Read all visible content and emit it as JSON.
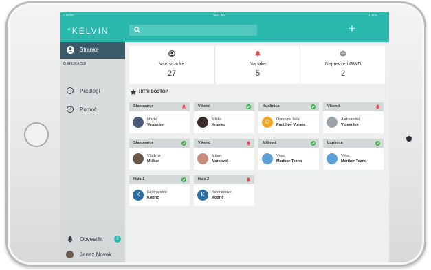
{
  "status_bar": {
    "carrier": "Carrier",
    "time": "9:41 AM",
    "battery": "100%"
  },
  "app": {
    "logo": "°KELVIN",
    "accent": "#2bb8ad"
  },
  "search": {
    "placeholder": ""
  },
  "sidebar": {
    "active": {
      "label": "Stranke",
      "icon": "user-circle-icon"
    },
    "section_label": "O APLIKACIJI",
    "items": [
      {
        "label": "Predlogi",
        "icon": "chat-bubble-icon"
      },
      {
        "label": "Pomoč",
        "icon": "help-icon"
      }
    ],
    "notifications": {
      "label": "Obvestila",
      "count": "2",
      "icon": "bell-icon"
    },
    "user": {
      "name": "Janez Novak"
    }
  },
  "stats": [
    {
      "label": "Vse stranke",
      "value": "27",
      "icon": "user-circle-icon",
      "color": "#333333"
    },
    {
      "label": "Napake",
      "value": "5",
      "icon": "bell-icon",
      "color": "#e84b4b"
    },
    {
      "label": "Neprevzeti GWD",
      "value": "2",
      "icon": "dots-icon",
      "color": "#8a8a8a"
    }
  ],
  "quick_access": {
    "title": "HITRI DOSTOP",
    "cards": [
      {
        "title": "Stanovanje",
        "status": "alert",
        "line1": "Marko",
        "line2": "Verderber",
        "avatar_color": "#4a5a78"
      },
      {
        "title": "Vikend",
        "status": "ok",
        "line1": "Miško",
        "line2": "Kranjec",
        "avatar_color": "#3b2b2b"
      },
      {
        "title": "Kuslinica",
        "status": "ok",
        "line1": "Osnovna šola",
        "line2": "Prežihov Voranc",
        "avatar_color": "#f5a623",
        "avatar_text": "O"
      },
      {
        "title": "Vikend",
        "status": "alert",
        "line1": "Aleksander",
        "line2": "Videmšek",
        "avatar_color": "#9aa4aa"
      },
      {
        "title": "Stanovanje",
        "status": "ok",
        "line1": "Vladimir",
        "line2": "Miškar",
        "avatar_color": "#6b5a4a"
      },
      {
        "title": "Vikend",
        "status": "alert",
        "line1": "Miran",
        "line2": "Marković",
        "avatar_color": "#c98b7b"
      },
      {
        "title": "Mišmaš",
        "status": "ok",
        "line1": "Vrtec",
        "line2": "Maribor Tezno",
        "avatar_color": "#5aa0d8"
      },
      {
        "title": "Lupinica",
        "status": "ok",
        "line1": "Vrtec",
        "line2": "Maribor Tezno",
        "avatar_color": "#5aa0d8"
      },
      {
        "title": "Hala 1",
        "status": "ok",
        "line1": "Kovinarstvo",
        "line2": "Kodrič",
        "avatar_color": "#2f6fa8",
        "avatar_text": "K"
      },
      {
        "title": "Hala 2",
        "status": "alert",
        "line1": "Kovinarstvo",
        "line2": "Kodrič",
        "avatar_color": "#2f6fa8",
        "avatar_text": "K"
      }
    ]
  },
  "colors": {
    "ok": "#3cb04a",
    "alert": "#e84b4b",
    "sidebar_active": "#3a5a6a"
  }
}
